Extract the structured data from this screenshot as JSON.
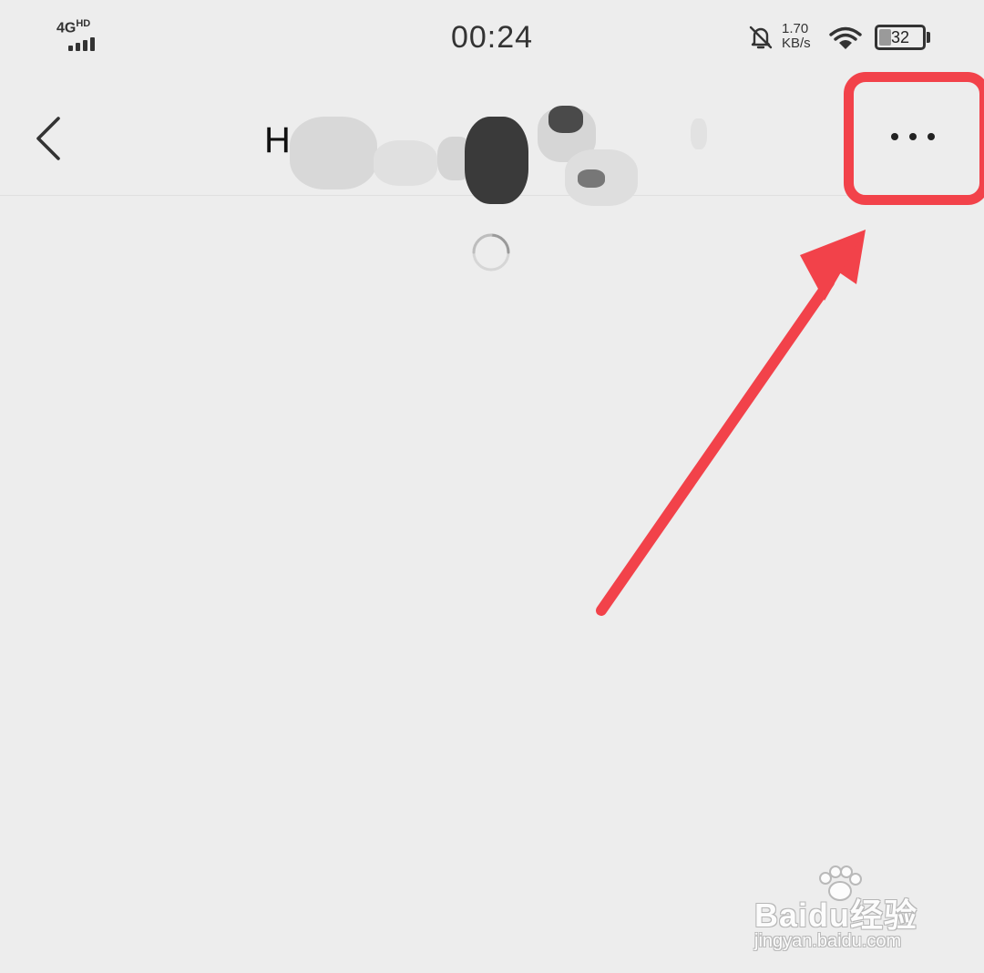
{
  "status_bar": {
    "network": "4G",
    "network_suffix": "HD",
    "time": "00:24",
    "speed_value": "1.70",
    "speed_unit": "KB/s",
    "battery_level": "32",
    "icons": [
      "signal-icon",
      "bell-off-icon",
      "wifi-icon",
      "battery-icon"
    ]
  },
  "nav": {
    "title_visible_prefix": "H",
    "title_redacted": true,
    "icons": [
      "back-icon",
      "more-icon"
    ]
  },
  "content": {
    "loading": true
  },
  "annotation": {
    "highlight_color": "#f2424a",
    "arrow_color": "#f2424a"
  },
  "watermark": {
    "logo_text": "Baidu经验",
    "url": "jingyan.baidu.com"
  },
  "colors": {
    "background": "#ededed",
    "text": "#222222",
    "accent": "#f2424a"
  }
}
